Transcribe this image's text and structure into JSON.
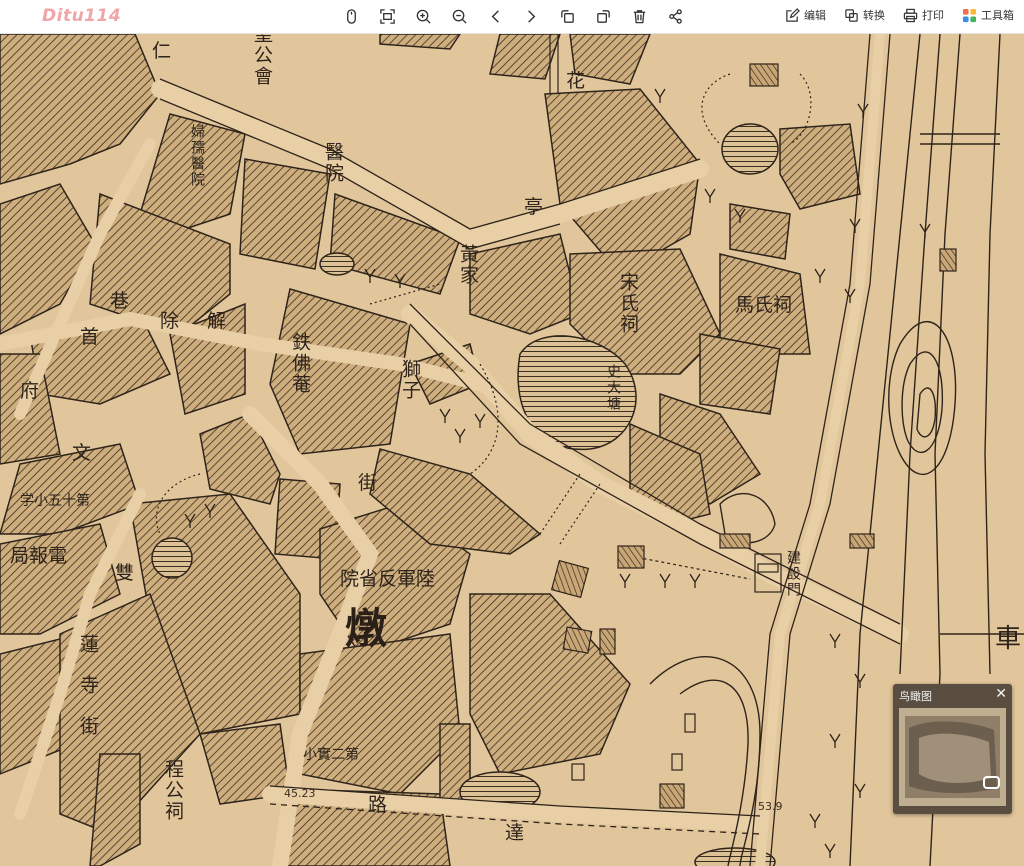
{
  "app": {
    "logo": "Ditu114"
  },
  "toolbar": {
    "tools": [
      "mouse-icon",
      "fit-screen-icon",
      "zoom-in-icon",
      "zoom-out-icon",
      "previous-icon",
      "next-icon",
      "rotate-left-icon",
      "rotate-right-icon",
      "delete-icon",
      "share-icon"
    ],
    "edit_label": "编辑",
    "convert_label": "转换",
    "print_label": "打印",
    "toolbox_label": "工具箱"
  },
  "map": {
    "labels": {
      "ren": "仁",
      "sheng_gong_hui": "聖公會",
      "fu_ru_yi_yuan": "婦孺醫院",
      "yi_yuan": "醫院",
      "hua": "花",
      "ting": "亭",
      "huang_jia": "黃家",
      "song_shi_ci": "宋氏祠",
      "ma_shi_ci": "馬氏祠",
      "xiang": "巷",
      "shou": "首",
      "chu_jie": "除解",
      "tie_fo_an": "鉄佛菴",
      "shi_zi": "獅子",
      "jie": "街",
      "fu": "府",
      "shi_da_tang": "史大塘",
      "wen": "文",
      "school_15": "第十五小学",
      "telegraph": "電報局",
      "shuang": "雙",
      "lian_si_jie": "蓮寺街",
      "army_hospital": "陸軍反省院",
      "big_char": "燉",
      "cheng_gong_ci": "程公祠",
      "school_2": "第二實小",
      "lu": "路",
      "da": "達",
      "jian_she_men": "建設門",
      "che": "車",
      "elev_left": "45.23",
      "elev_right": "53.9"
    }
  },
  "overview": {
    "title": "鸟瞰图",
    "close": "✕"
  },
  "colors": {
    "paper": "#e2c69b",
    "ink": "#2e241b",
    "hatch": "#3b2e22",
    "road": "#e8cfa6"
  }
}
